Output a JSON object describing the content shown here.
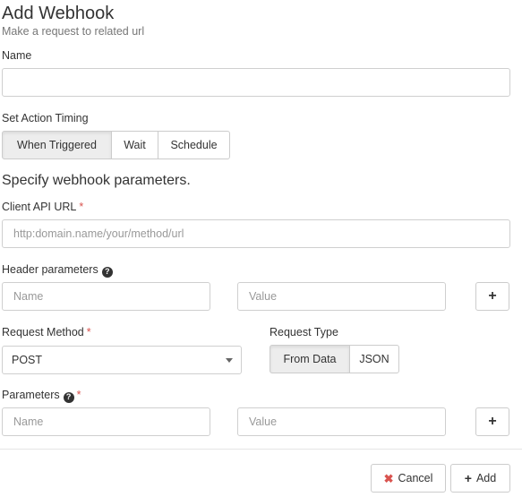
{
  "header": {
    "title": "Add Webhook",
    "subtitle": "Make a request to related url"
  },
  "name_field": {
    "label": "Name",
    "value": "",
    "placeholder": ""
  },
  "action_timing": {
    "label": "Set Action Timing",
    "options": [
      "When Triggered",
      "Wait",
      "Schedule"
    ],
    "selected": "When Triggered"
  },
  "section_title": "Specify webhook parameters.",
  "client_api_url": {
    "label": "Client API URL",
    "required_mark": "*",
    "value": "",
    "placeholder": "http:domain.name/your/method/url"
  },
  "header_parameters": {
    "label": "Header parameters",
    "help_icon": "question-circle-icon",
    "name_placeholder": "Name",
    "value_placeholder": "Value",
    "add_icon": "plus-icon"
  },
  "request_method": {
    "label": "Request Method",
    "required_mark": "*",
    "selected": "POST"
  },
  "request_type": {
    "label": "Request Type",
    "options": [
      "From Data",
      "JSON"
    ],
    "selected": "From Data"
  },
  "parameters": {
    "label": "Parameters",
    "required_mark": "*",
    "help_icon": "question-circle-icon",
    "name_placeholder": "Name",
    "value_placeholder": "Value",
    "add_icon": "plus-icon"
  },
  "footer": {
    "cancel_label": "Cancel",
    "add_label": "Add",
    "cancel_icon": "x-icon",
    "add_icon": "plus-icon"
  },
  "colors": {
    "required": "#d9534f",
    "active_segment": "#ededed",
    "border": "#cccccc"
  }
}
